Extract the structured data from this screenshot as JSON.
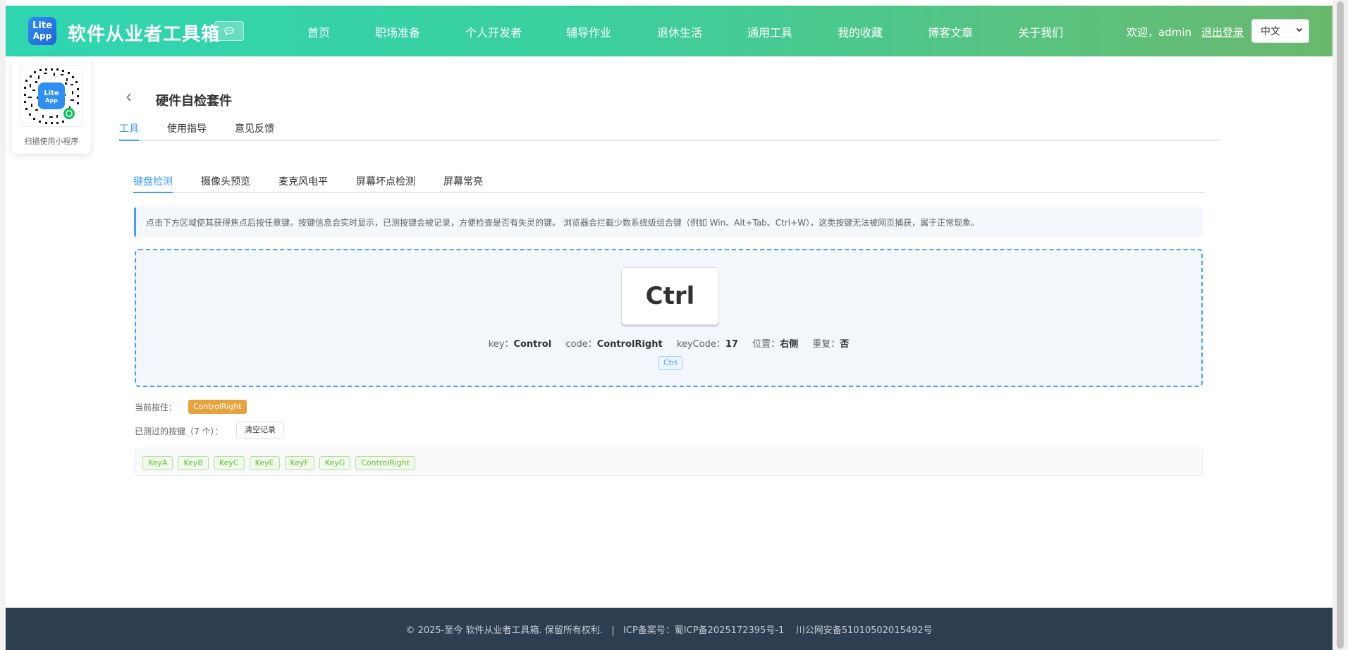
{
  "header": {
    "logo_line1": "Lite",
    "logo_line2": "App",
    "site_title": "软件从业者工具箱",
    "chat_icon": "chat-bubble-icon",
    "nav": [
      "首页",
      "职场准备",
      "个人开发者",
      "辅导作业",
      "退休生活",
      "通用工具",
      "我的收藏",
      "博客文章",
      "关于我们"
    ],
    "welcome": "欢迎，admin",
    "logout": "退出登录",
    "language": "中文"
  },
  "qr": {
    "caption": "扫描使用小程序"
  },
  "page": {
    "title": "硬件自检套件",
    "tabs": [
      "工具",
      "使用指导",
      "意见反馈"
    ],
    "active_tab": 0
  },
  "tool": {
    "tabs": [
      "键盘检测",
      "摄像头预览",
      "麦克风电平",
      "屏幕坏点检测",
      "屏幕常亮"
    ],
    "active_tab": 0,
    "info": "点击下方区域使其获得焦点后按任意键。按键信息会实时显示，已测按键会被记录，方便检查是否有失灵的键。 浏览器会拦截少数系统级组合键（例如 Win、Alt+Tab、Ctrl+W），这类按键无法被网页捕获，属于正常现象。",
    "key_display": "Ctrl",
    "key_info": {
      "key_label": "key：",
      "key_value": "Control",
      "code_label": "code：",
      "code_value": "ControlRight",
      "keycode_label": "keyCode：",
      "keycode_value": "17",
      "position_label": "位置：",
      "position_value": "右侧",
      "repeat_label": "重复：",
      "repeat_value": "否"
    },
    "modifier_tag": "Ctrl",
    "current_label": "当前按住：",
    "current_key": "ControlRight",
    "tested_label": "已测过的按键（7 个）：",
    "clear_button": "清空记录",
    "tested_keys": [
      "KeyA",
      "KeyB",
      "KeyC",
      "KeyE",
      "KeyF",
      "KeyG",
      "ControlRight"
    ]
  },
  "footer": {
    "text": "© 2025-至今 软件从业者工具箱. 保留所有权利.   |   ICP备案号：蜀ICP备2025172395号-1    川公网安备51010502015492号"
  },
  "colors": {
    "accent": "#409eff",
    "header_start": "#2fd6b0",
    "header_end": "#6ab86e",
    "footer_bg": "#2c3e50",
    "pressed_tag": "#e6a23c",
    "tested_tag": "#67c23a"
  }
}
